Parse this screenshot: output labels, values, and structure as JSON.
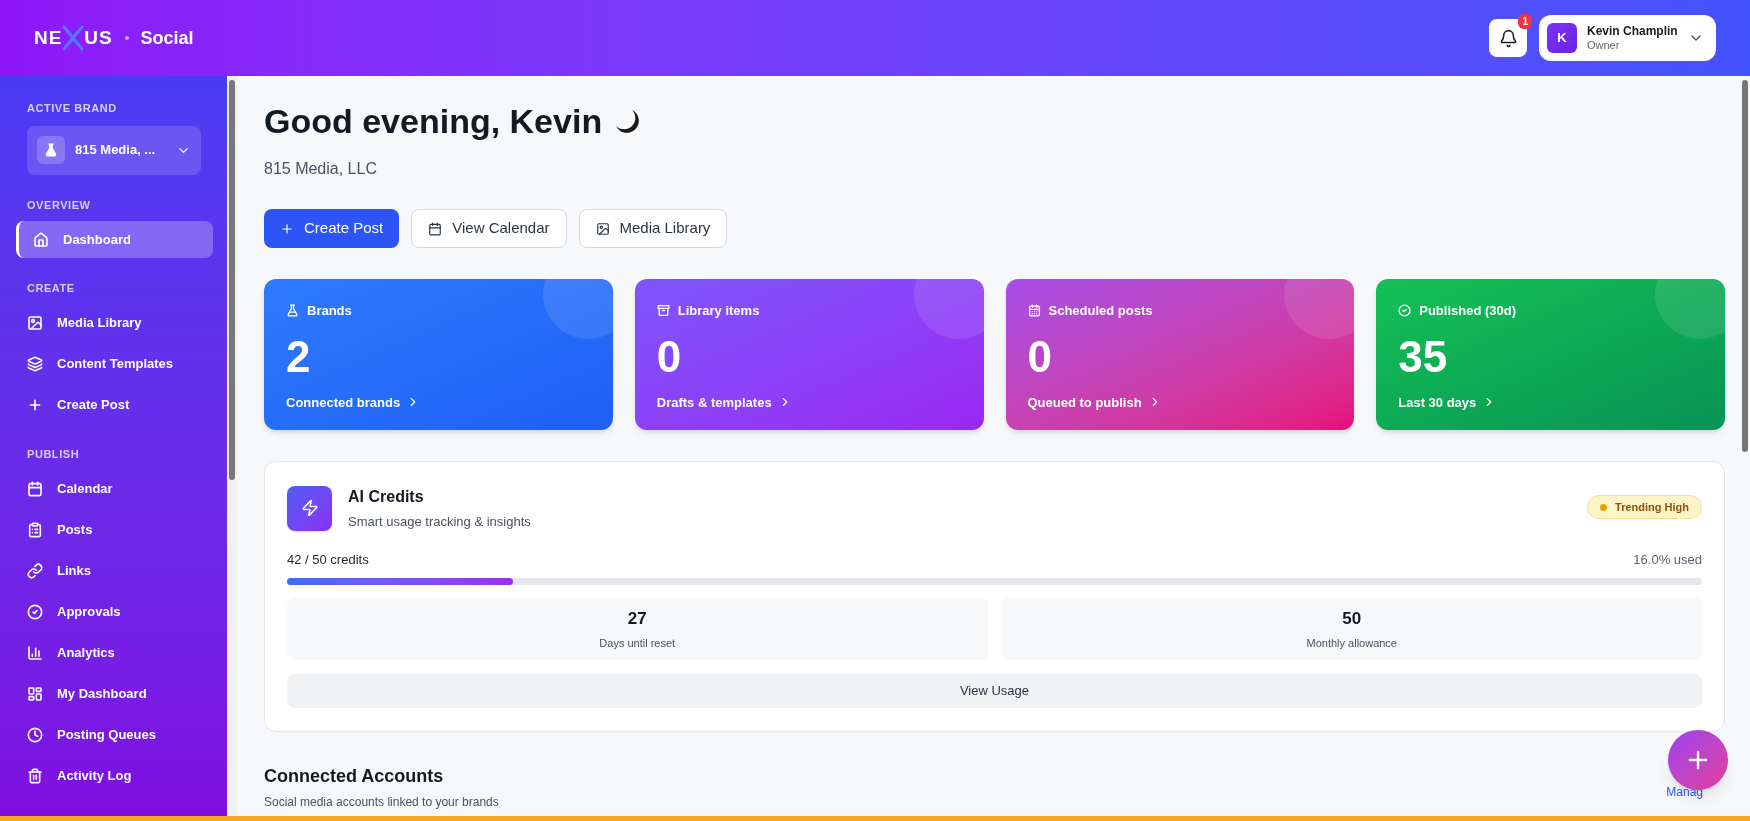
{
  "header": {
    "logo_left": "NE",
    "logo_right": "US",
    "product": "Social",
    "notifications": {
      "count": "1"
    },
    "user": {
      "initial": "K",
      "name": "Kevin Champlin",
      "role": "Owner"
    }
  },
  "sidebar": {
    "active_brand_label": "ACTIVE BRAND",
    "brand": "815 Media, ...",
    "sections": [
      {
        "title": "OVERVIEW",
        "items": [
          {
            "label": "Dashboard",
            "selected": true
          }
        ]
      },
      {
        "title": "CREATE",
        "items": [
          {
            "label": "Media Library",
            "selected": false
          },
          {
            "label": "Content Templates",
            "selected": false
          },
          {
            "label": "Create Post",
            "selected": false
          }
        ]
      },
      {
        "title": "PUBLISH",
        "items": [
          {
            "label": "Calendar",
            "selected": false
          },
          {
            "label": "Posts",
            "selected": false
          },
          {
            "label": "Links",
            "selected": false
          },
          {
            "label": "Approvals",
            "selected": false
          },
          {
            "label": "Analytics",
            "selected": false
          },
          {
            "label": "My Dashboard",
            "selected": false
          },
          {
            "label": "Posting Queues",
            "selected": false
          },
          {
            "label": "Activity Log",
            "selected": false
          }
        ]
      }
    ]
  },
  "greeting": "Good evening, Kevin",
  "company": "815 Media, LLC",
  "actions": [
    {
      "label": "Create Post",
      "kind": "primary"
    },
    {
      "label": "View Calendar",
      "kind": "secondary"
    },
    {
      "label": "Media Library",
      "kind": "secondary"
    }
  ],
  "stats": [
    {
      "label": "Brands",
      "value": "2",
      "caption": "Connected brands"
    },
    {
      "label": "Library items",
      "value": "0",
      "caption": "Drafts & templates"
    },
    {
      "label": "Scheduled posts",
      "value": "0",
      "caption": "Queued to publish"
    },
    {
      "label": "Published (30d)",
      "value": "35",
      "caption": "Last 30 days"
    }
  ],
  "ai_credits": {
    "title": "AI Credits",
    "subtitle": "Smart usage tracking & insights",
    "badge": "Trending High",
    "credits": "42 / 50 credits",
    "used": "16.0% used",
    "level": 0.16,
    "figures": [
      {
        "value": "27",
        "label": "Days until reset"
      },
      {
        "value": "50",
        "label": "Monthly allowance"
      }
    ],
    "button": "View Usage"
  },
  "connected_accounts": {
    "title": "Connected Accounts",
    "subtitle": "Social media accounts linked to your brands",
    "link": "Manag"
  }
}
